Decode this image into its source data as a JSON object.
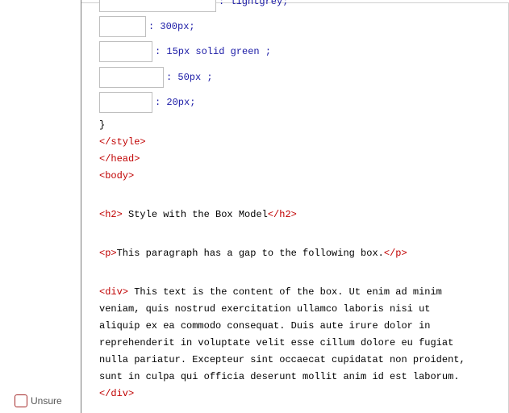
{
  "code": {
    "partial_top_value": ": lightgrey;",
    "rows": [
      {
        "value": ": 300px;"
      },
      {
        "value": ": 15px solid green ;"
      },
      {
        "value": ": 50px ;"
      },
      {
        "value": ": 20px;"
      }
    ],
    "close_brace": "}",
    "style_close": "</style>",
    "head_close": "</head>",
    "body_open": "<body>",
    "h2_open": "<h2>",
    "h2_text": " Style with the Box Model",
    "h2_close": "</h2>",
    "p_open": "<p>",
    "p_text": "This paragraph has a gap to the following box.",
    "p_close": "</p>",
    "div_open": "<div>",
    "div_lines": [
      " This text is the content of the box. Ut enim ad minim",
      "veniam, quis nostrud exercitation ullamco laboris nisi ut",
      "aliquip ex ea commodo consequat. Duis aute irure dolor in",
      "reprehenderit in voluptate velit esse cillum dolore eu fugiat",
      "nulla pariatur. Excepteur sint occaecat cupidatat non proident,",
      "sunt in culpa qui officia deserunt mollit anim id est laborum."
    ],
    "div_close": "</div>"
  },
  "unsure": {
    "label": "Unsure"
  }
}
